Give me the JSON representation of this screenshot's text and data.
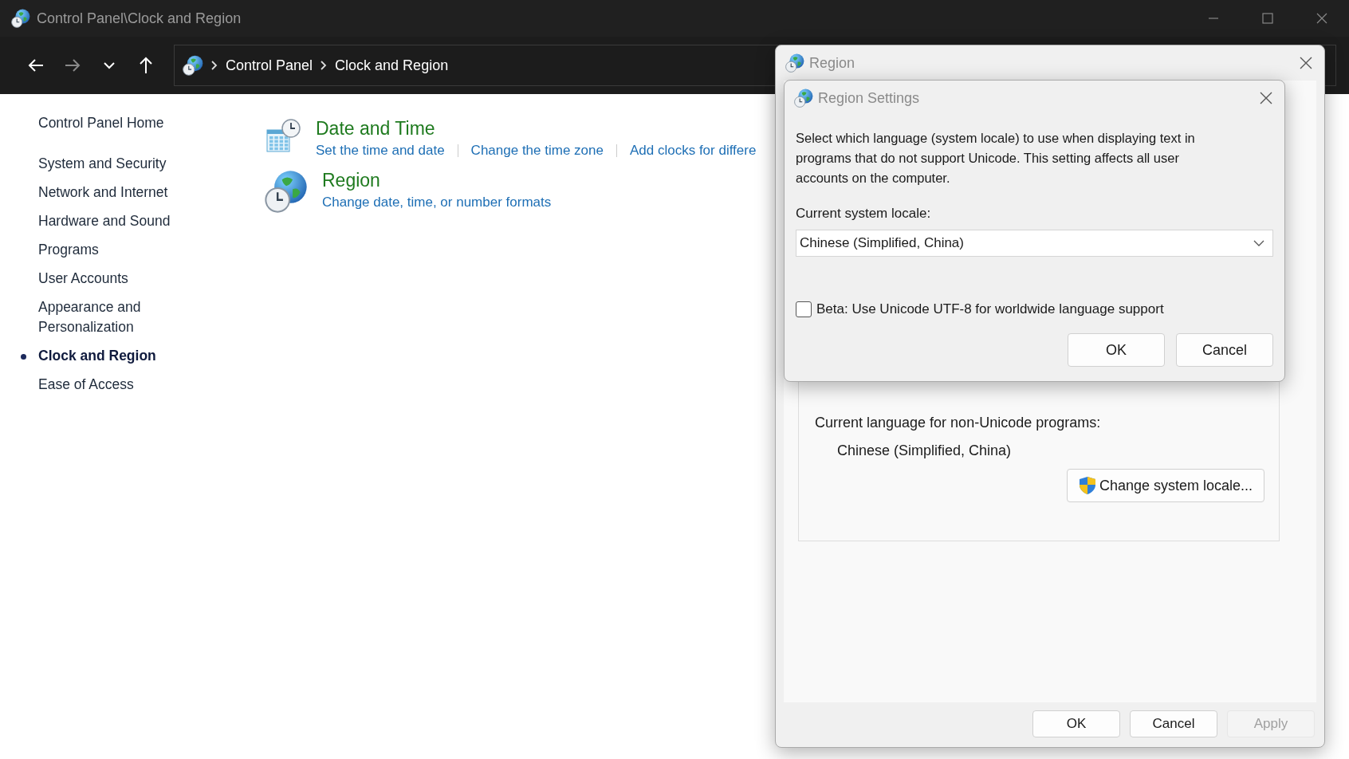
{
  "window": {
    "title": "Control Panel\\Clock and Region"
  },
  "nav_buttons": [
    {
      "kind": "back",
      "disabled": false
    },
    {
      "kind": "forward",
      "disabled": true
    },
    {
      "kind": "recent",
      "disabled": false
    },
    {
      "kind": "up",
      "disabled": false
    }
  ],
  "breadcrumb": [
    "Control Panel",
    "Clock and Region"
  ],
  "sidebar": {
    "items": [
      {
        "label": "Control Panel Home",
        "selected": false
      },
      {
        "label": "System and Security",
        "selected": false
      },
      {
        "label": "Network and Internet",
        "selected": false
      },
      {
        "label": "Hardware and Sound",
        "selected": false
      },
      {
        "label": "Programs",
        "selected": false
      },
      {
        "label": "User Accounts",
        "selected": false
      },
      {
        "label": "Appearance and Personalization",
        "selected": false
      },
      {
        "label": "Clock and Region",
        "selected": true
      },
      {
        "label": "Ease of Access",
        "selected": false
      }
    ]
  },
  "categories": [
    {
      "kind": "datetime",
      "title": "Date and Time",
      "links": [
        "Set the time and date",
        "Change the time zone",
        "Add clocks for differe"
      ]
    },
    {
      "kind": "region",
      "title": "Region",
      "links": [
        "Change date, time, or number formats"
      ]
    }
  ],
  "region_dialog": {
    "title": "Region",
    "current_language_label": "Current language for non-Unicode programs:",
    "current_language": "Chinese (Simplified, China)",
    "change_button": "Change system locale...",
    "buttons": [
      {
        "label": "OK",
        "disabled": false
      },
      {
        "label": "Cancel",
        "disabled": false
      },
      {
        "label": "Apply",
        "disabled": true
      }
    ]
  },
  "settings_dialog": {
    "title": "Region Settings",
    "description": "Select which language (system locale) to use when displaying text in programs that do not support Unicode. This setting affects all user accounts on the computer.",
    "locale_label": "Current system locale:",
    "locale": "Chinese (Simplified, China)",
    "utf8": {
      "label": "Beta: Use Unicode UTF-8 for worldwide language support",
      "checked": false
    },
    "buttons": [
      "OK",
      "Cancel"
    ]
  }
}
